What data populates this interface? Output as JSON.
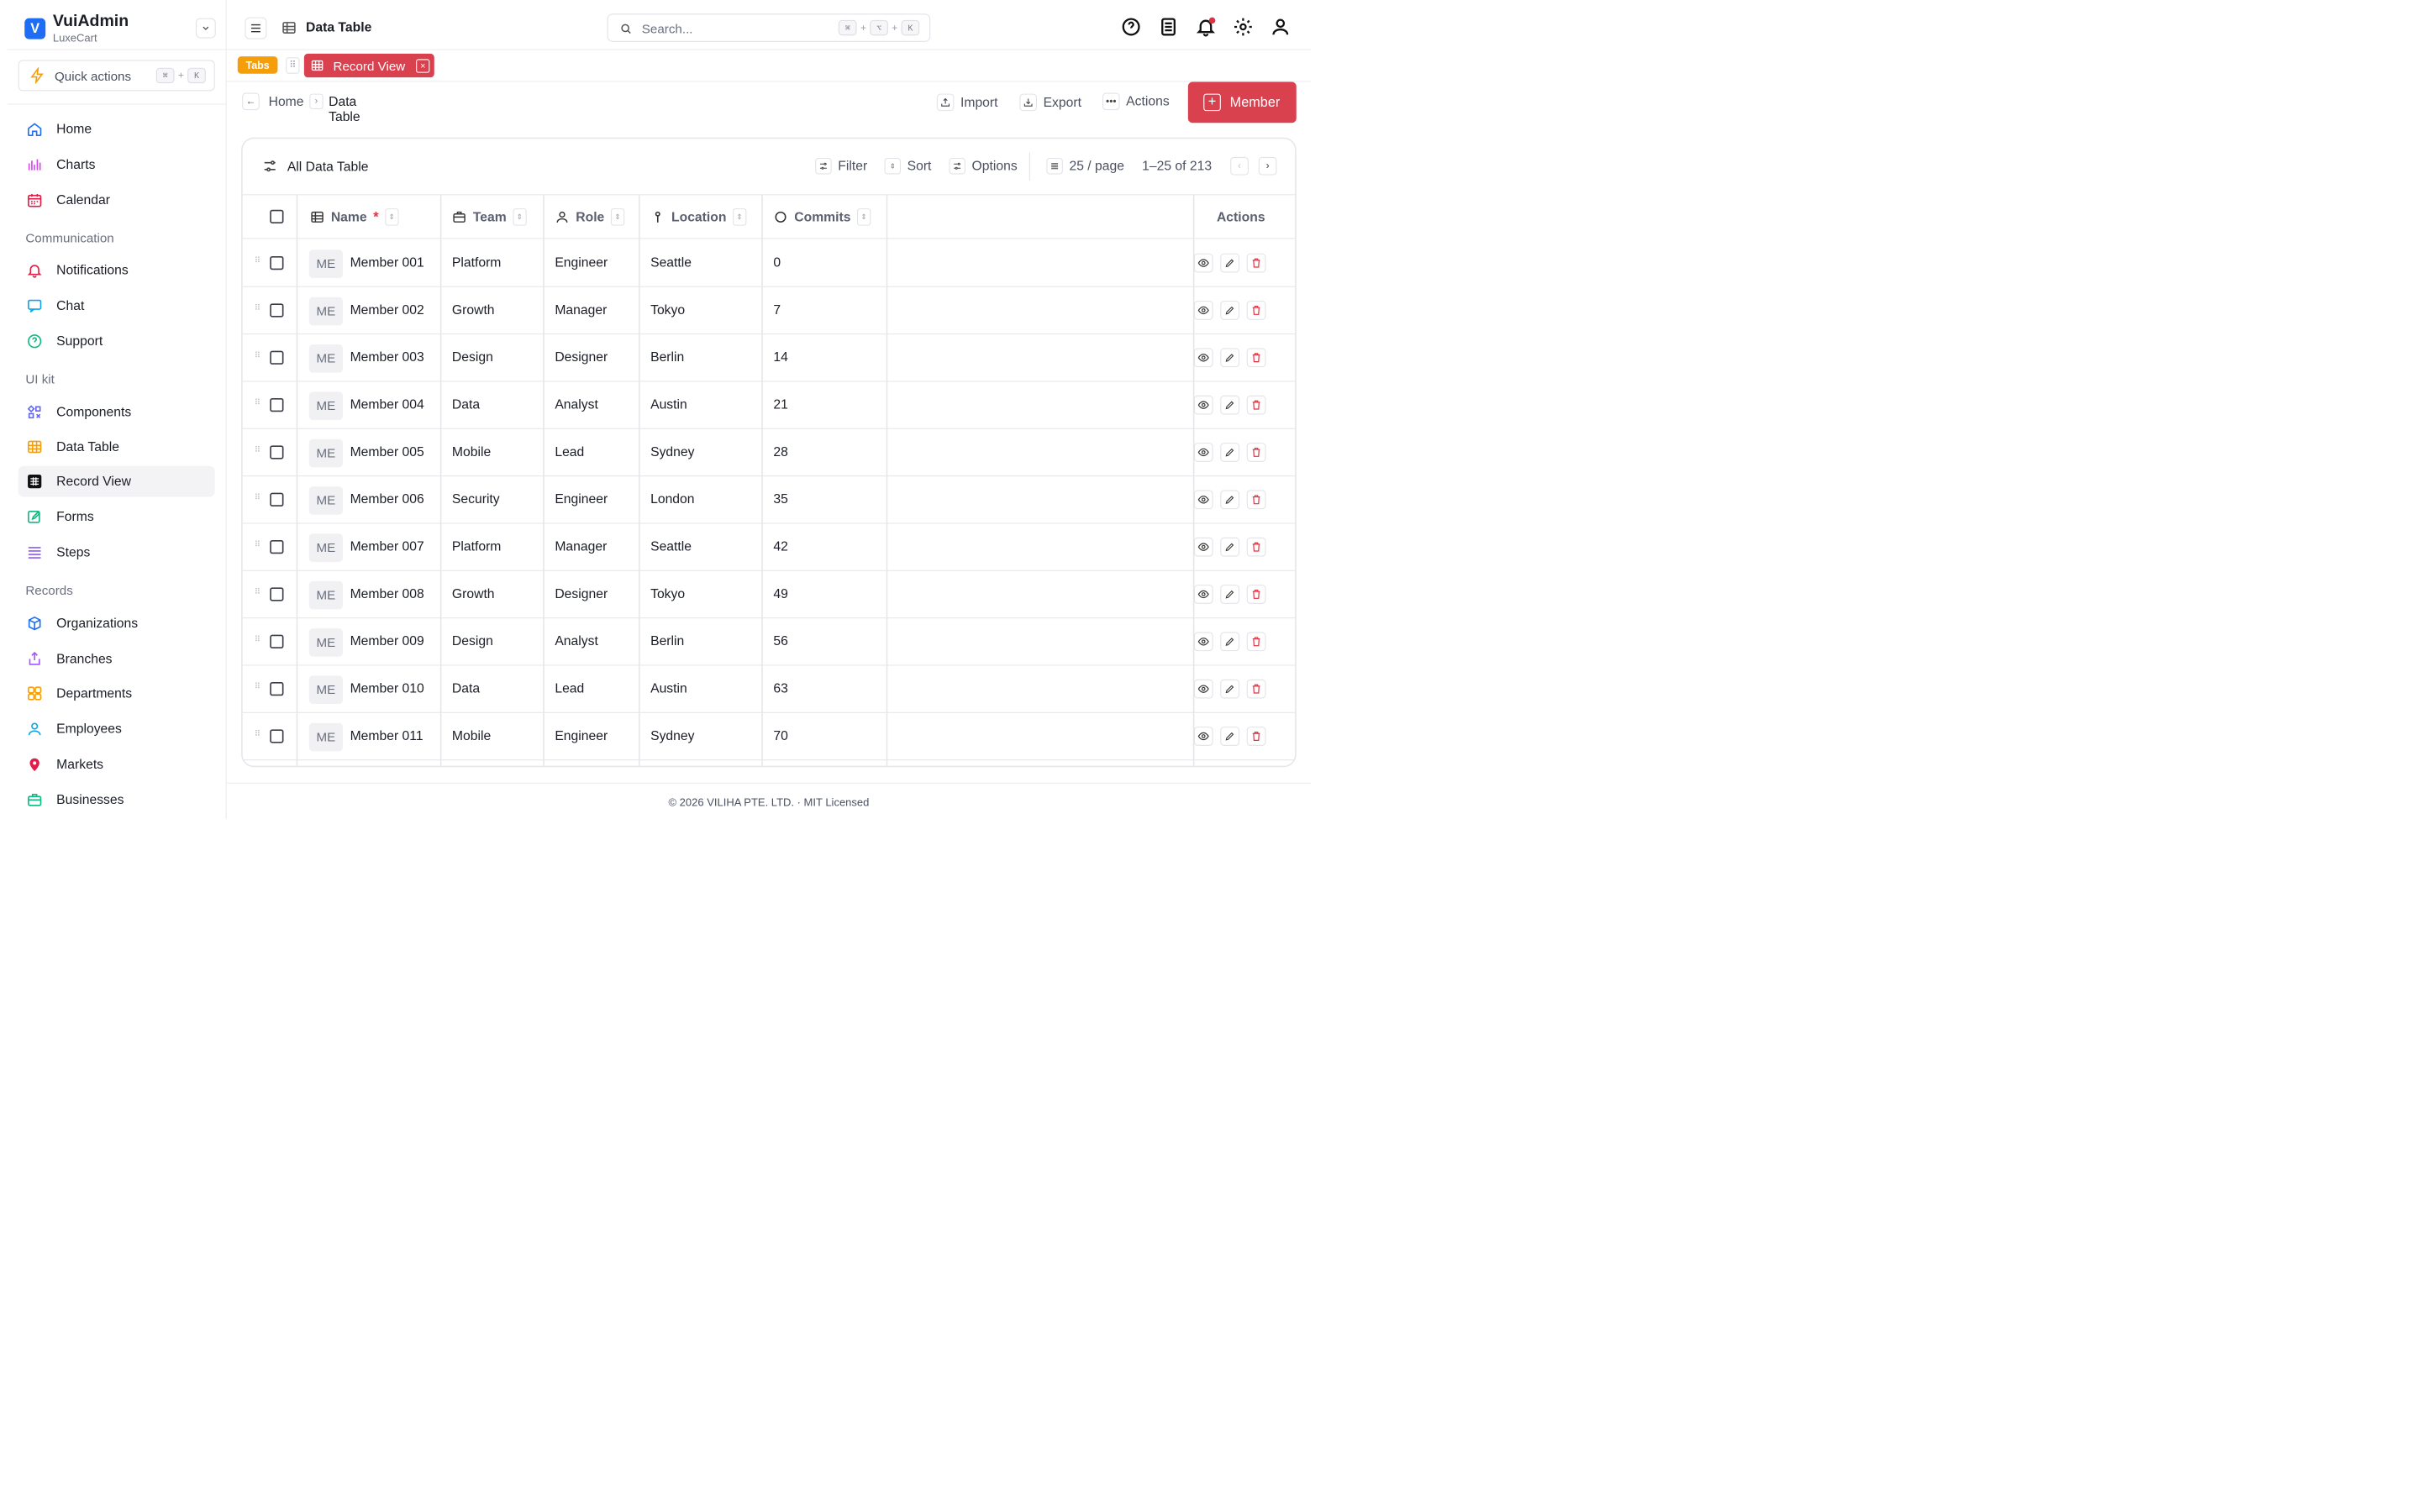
{
  "brand": {
    "name": "VuiAdmin",
    "sub": "LuxeCart",
    "logo_letter": "V"
  },
  "quick_actions": {
    "label": "Quick actions",
    "key1": "⌘",
    "plus": "+",
    "key2": "K"
  },
  "nav": {
    "main": [
      {
        "label": "Home",
        "icon": "home-icon"
      },
      {
        "label": "Charts",
        "icon": "bar-chart-icon"
      },
      {
        "label": "Calendar",
        "icon": "calendar-icon"
      }
    ],
    "sections": [
      {
        "title": "Communication",
        "items": [
          {
            "label": "Notifications",
            "icon": "bell-icon"
          },
          {
            "label": "Chat",
            "icon": "chat-icon"
          },
          {
            "label": "Support",
            "icon": "help-icon"
          }
        ]
      },
      {
        "title": "UI kit",
        "items": [
          {
            "label": "Components",
            "icon": "components-icon"
          },
          {
            "label": "Data Table",
            "icon": "table-icon"
          },
          {
            "label": "Record View",
            "icon": "record-view-icon",
            "active": true
          },
          {
            "label": "Forms",
            "icon": "form-icon"
          },
          {
            "label": "Steps",
            "icon": "steps-icon"
          }
        ]
      },
      {
        "title": "Records",
        "items": [
          {
            "label": "Organizations",
            "icon": "cube-icon"
          },
          {
            "label": "Branches",
            "icon": "branch-icon"
          },
          {
            "label": "Departments",
            "icon": "departments-icon"
          },
          {
            "label": "Employees",
            "icon": "user-icon"
          },
          {
            "label": "Markets",
            "icon": "map-pin-icon"
          },
          {
            "label": "Businesses",
            "icon": "briefcase-icon"
          }
        ]
      }
    ]
  },
  "topbar": {
    "title": "Data Table",
    "search_placeholder": "Search...",
    "search_keys": [
      "⌘",
      "+",
      "⌥",
      "+",
      "K"
    ],
    "icons": [
      "help-icon",
      "docs-icon",
      "bell-icon",
      "gear-icon",
      "user-icon"
    ]
  },
  "tabs": {
    "tag": "Tabs",
    "active": "Record View",
    "close": "×"
  },
  "breadcrumb": {
    "home": "Home",
    "sep": "›",
    "current": "Data Table"
  },
  "header_actions": {
    "import": "Import",
    "export": "Export",
    "actions": "Actions",
    "add": "Member"
  },
  "table_card": {
    "title": "All Data Table",
    "filter": "Filter",
    "sort": "Sort",
    "options": "Options",
    "page_size": "25 / page",
    "range": "1–25 of 213"
  },
  "columns": {
    "name": "Name",
    "required_mark": "*",
    "team": "Team",
    "role": "Role",
    "location": "Location",
    "commits": "Commits",
    "actions": "Actions"
  },
  "rows": [
    {
      "avatar": "ME",
      "name": "Member 001",
      "team": "Platform",
      "role": "Engineer",
      "location": "Seattle",
      "commits": "0"
    },
    {
      "avatar": "ME",
      "name": "Member 002",
      "team": "Growth",
      "role": "Manager",
      "location": "Tokyo",
      "commits": "7"
    },
    {
      "avatar": "ME",
      "name": "Member 003",
      "team": "Design",
      "role": "Designer",
      "location": "Berlin",
      "commits": "14"
    },
    {
      "avatar": "ME",
      "name": "Member 004",
      "team": "Data",
      "role": "Analyst",
      "location": "Austin",
      "commits": "21"
    },
    {
      "avatar": "ME",
      "name": "Member 005",
      "team": "Mobile",
      "role": "Lead",
      "location": "Sydney",
      "commits": "28"
    },
    {
      "avatar": "ME",
      "name": "Member 006",
      "team": "Security",
      "role": "Engineer",
      "location": "London",
      "commits": "35"
    },
    {
      "avatar": "ME",
      "name": "Member 007",
      "team": "Platform",
      "role": "Manager",
      "location": "Seattle",
      "commits": "42"
    },
    {
      "avatar": "ME",
      "name": "Member 008",
      "team": "Growth",
      "role": "Designer",
      "location": "Tokyo",
      "commits": "49"
    },
    {
      "avatar": "ME",
      "name": "Member 009",
      "team": "Design",
      "role": "Analyst",
      "location": "Berlin",
      "commits": "56"
    },
    {
      "avatar": "ME",
      "name": "Member 010",
      "team": "Data",
      "role": "Lead",
      "location": "Austin",
      "commits": "63"
    },
    {
      "avatar": "ME",
      "name": "Member 011",
      "team": "Mobile",
      "role": "Engineer",
      "location": "Sydney",
      "commits": "70"
    }
  ],
  "footer": "© 2026 VILIHA PTE. LTD. · MIT Licensed",
  "colors": {
    "accent": "#d9414f",
    "brand": "#1d6ef5",
    "tabs_tag": "#f59e0b",
    "danger": "#e03141"
  }
}
